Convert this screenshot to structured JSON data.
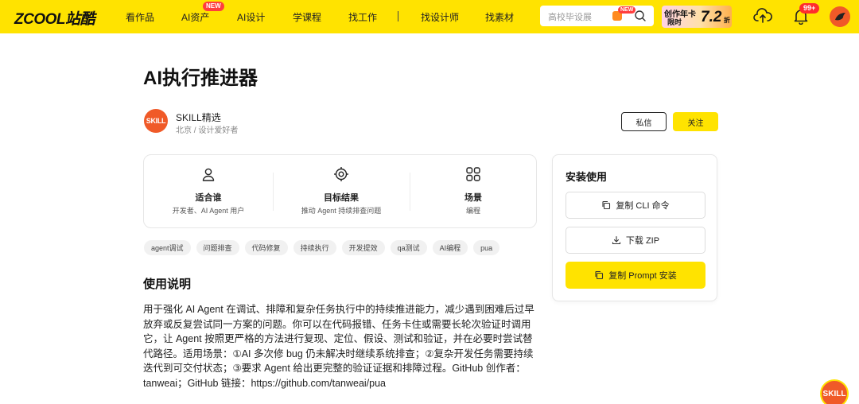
{
  "nav": {
    "logo": "ZCOOL站酷",
    "items": [
      "看作品",
      "AI资产",
      "AI设计",
      "学课程",
      "找工作",
      "找设计师",
      "找素材"
    ],
    "new_badge": "NEW",
    "search_placeholder": "高校毕设展",
    "search_new_badge": "NEW",
    "promo": {
      "line1": "创作年卡",
      "line2": "限时",
      "big": "7.2",
      "suffix": "折"
    },
    "notification_count": "99+"
  },
  "page": {
    "title": "AI执行推进器",
    "author": {
      "avatar_text": "SKILL",
      "name": "SKILL精选",
      "meta": "北京 / 设计爱好者"
    },
    "buttons": {
      "message": "私信",
      "follow": "关注"
    }
  },
  "info": [
    {
      "icon": "user-icon",
      "label": "适合谁",
      "value": "开发者、AI Agent 用户"
    },
    {
      "icon": "target-icon",
      "label": "目标结果",
      "value": "推动 Agent 持续排查问题"
    },
    {
      "icon": "grid-icon",
      "label": "场景",
      "value": "编程"
    }
  ],
  "tags": [
    "agent调试",
    "问题排查",
    "代码修复",
    "持续执行",
    "开发提效",
    "qa测试",
    "AI编程",
    "pua"
  ],
  "usage": {
    "title": "使用说明",
    "body": "用于强化 AI Agent 在调试、排障和复杂任务执行中的持续推进能力，减少遇到困难后过早放弃或反复尝试同一方案的问题。你可以在代码报错、任务卡住或需要长轮次验证时调用它，让 Agent 按照更严格的方法进行复现、定位、假设、测试和验证，并在必要时尝试替代路径。适用场景：①AI 多次修 bug 仍未解决时继续系统排查；②复杂开发任务需要持续迭代到可交付状态；③要求 Agent 给出更完整的验证证据和排障过程。GitHub 创作者：tanweai；GitHub 链接：https://github.com/tanweai/pua"
  },
  "install": {
    "title": "安装使用",
    "copy_cli": "复制 CLI 命令",
    "download_zip": "下载 ZIP",
    "copy_prompt": "复制 Prompt 安装"
  },
  "float_badge": "SKILL",
  "colors": {
    "brand_yellow": "#ffe300",
    "accent_orange": "#f05a28",
    "badge_red": "#ff3d3d"
  }
}
